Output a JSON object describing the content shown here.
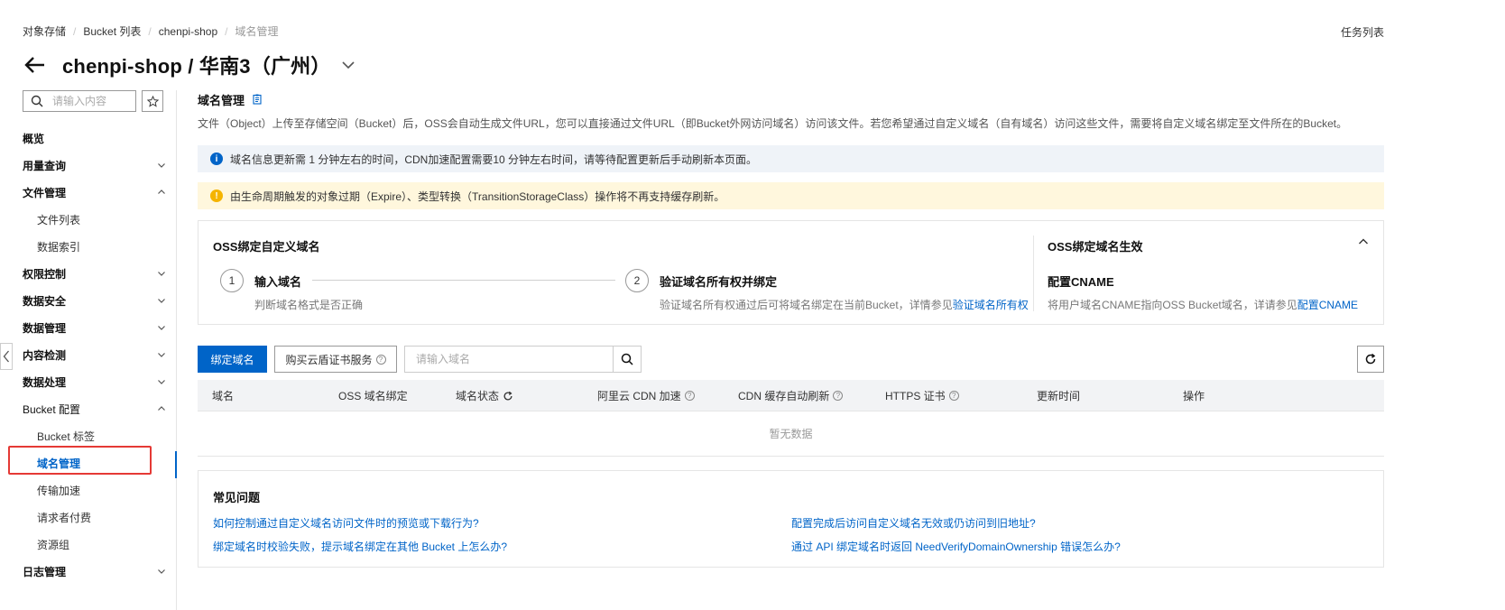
{
  "breadcrumb": [
    "对象存储",
    "Bucket 列表",
    "chenpi-shop",
    "域名管理"
  ],
  "header": {
    "task_list": "任务列表",
    "title": "chenpi-shop / 华南3（广州）"
  },
  "sidebar": {
    "search_placeholder": "请输入内容",
    "items": [
      {
        "label": "概览",
        "level": 1,
        "chevron": "none"
      },
      {
        "label": "用量查询",
        "level": 1,
        "chevron": "down"
      },
      {
        "label": "文件管理",
        "level": 1,
        "chevron": "up"
      },
      {
        "label": "文件列表",
        "level": 2
      },
      {
        "label": "数据索引",
        "level": 2
      },
      {
        "label": "权限控制",
        "level": 1,
        "chevron": "down"
      },
      {
        "label": "数据安全",
        "level": 1,
        "chevron": "down"
      },
      {
        "label": "数据管理",
        "level": 1,
        "chevron": "down"
      },
      {
        "label": "内容检测",
        "level": 1,
        "chevron": "down"
      },
      {
        "label": "数据处理",
        "level": 1,
        "chevron": "down"
      },
      {
        "label": "Bucket 配置",
        "level": 1,
        "chevron": "up"
      },
      {
        "label": "Bucket 标签",
        "level": 2
      },
      {
        "label": "域名管理",
        "level": 2,
        "active": true
      },
      {
        "label": "传输加速",
        "level": 2
      },
      {
        "label": "请求者付费",
        "level": 2
      },
      {
        "label": "资源组",
        "level": 2
      },
      {
        "label": "日志管理",
        "level": 1,
        "chevron": "down"
      }
    ]
  },
  "main": {
    "section_title": "域名管理",
    "description": "文件（Object）上传至存储空间（Bucket）后，OSS会自动生成文件URL，您可以直接通过文件URL（即Bucket外网访问域名）访问该文件。若您希望通过自定义域名（自有域名）访问这些文件，需要将自定义域名绑定至文件所在的Bucket。",
    "alert_info": "域名信息更新需 1 分钟左右的时间，CDN加速配置需要10 分钟左右时间，请等待配置更新后手动刷新本页面。",
    "alert_warn": "由生命周期触发的对象过期（Expire）、类型转换（TransitionStorageClass）操作将不再支持缓存刷新。",
    "steps_card": {
      "title": "OSS绑定自定义域名",
      "step1_num": "1",
      "step1_label": "输入域名",
      "step1_desc": "判断域名格式是否正确",
      "step2_num": "2",
      "step2_label": "验证域名所有权并绑定",
      "step2_desc": "验证域名所有权通过后可将域名绑定在当前Bucket，详情参见",
      "step2_link": "验证域名所有权",
      "right_title": "OSS绑定域名生效",
      "cname_title": "配置CNAME",
      "cname_desc": "将用户域名CNAME指向OSS Bucket域名，详请参见",
      "cname_link": "配置CNAME"
    },
    "toolbar": {
      "bind_label": "绑定域名",
      "buy_cert_label": "购买云盾证书服务",
      "domain_placeholder": "请输入域名"
    },
    "table": {
      "columns": [
        "域名",
        "OSS 域名绑定",
        "域名状态",
        "阿里云 CDN 加速",
        "CDN 缓存自动刷新",
        "HTTPS 证书",
        "更新时间",
        "操作"
      ],
      "empty_text": "暂无数据"
    },
    "faq": {
      "title": "常见问题",
      "links": [
        "如何控制通过自定义域名访问文件时的预览或下载行为?",
        "配置完成后访问自定义域名无效或仍访问到旧地址?",
        "绑定域名时校验失败，提示域名绑定在其他 Bucket 上怎么办?",
        "通过 API 绑定域名时返回 NeedVerifyDomainOwnership 错误怎么办?"
      ]
    }
  },
  "colors": {
    "accent": "#0064c8",
    "info_bg": "#eff3f8",
    "warn_bg": "#fff7dd",
    "highlight": "#e53935"
  }
}
